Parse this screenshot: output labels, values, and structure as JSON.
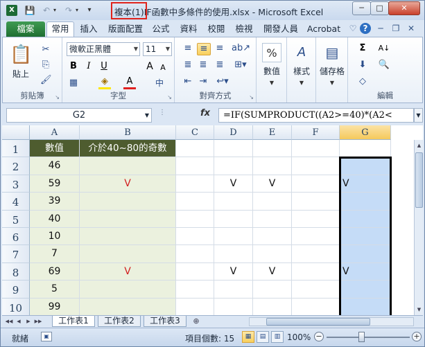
{
  "window": {
    "title": "複本(1)IF函數中多條件的使用.xlsx - Microsoft Excel",
    "minimize": "─",
    "maximize": "□",
    "close": "✕"
  },
  "quick_access": {
    "logo": "X",
    "save": "💾",
    "undo": "↶",
    "redo": "↷",
    "dropdown": "▾"
  },
  "tabs": {
    "file": "檔案",
    "items": [
      "常用",
      "插入",
      "版面配置",
      "公式",
      "資料",
      "校閱",
      "檢視",
      "開發人員",
      "Acrobat"
    ],
    "active": "常用",
    "icons": {
      "collapse": "♡",
      "help": "?",
      "min": "─",
      "restore": "❐",
      "close": "✕"
    }
  },
  "ribbon": {
    "clipboard": {
      "label": "剪貼簿",
      "paste": "貼上",
      "cut": "✂",
      "copy": "⎘",
      "format_painter": "🖌"
    },
    "font": {
      "label": "字型",
      "font_name": "微軟正黑體",
      "font_size": "11",
      "grow": "A",
      "shrink": "A",
      "bold": "B",
      "italic": "I",
      "underline": "U",
      "border": "▦",
      "fill": "◈",
      "color": "A",
      "phonetic": "中"
    },
    "alignment": {
      "label": "對齊方式"
    },
    "number": {
      "label": "數值",
      "icon": "%"
    },
    "styles": {
      "label": "樣式",
      "icon": "A"
    },
    "cells": {
      "label": "儲存格",
      "icon": "▤"
    },
    "editing": {
      "label": "編輯",
      "sum": "Σ",
      "sort": "A↓",
      "find": "🔍",
      "fill": "⬇",
      "clear": "◇"
    }
  },
  "formula_bar": {
    "name_box": "G2",
    "fx": "fx",
    "formula": "=IF(SUMPRODUCT((A2>=40)*(A2<"
  },
  "columns": [
    "A",
    "B",
    "C",
    "D",
    "E",
    "F",
    "G"
  ],
  "active_column": "G",
  "rows": [
    "1",
    "2",
    "3",
    "4",
    "5",
    "6",
    "7",
    "8",
    "9",
    "10"
  ],
  "cells": {
    "header_a": "數值",
    "header_b": "介於40~80的奇數",
    "a_values": [
      "46",
      "59",
      "39",
      "40",
      "10",
      "7",
      "69",
      "5",
      "99"
    ],
    "b_values": [
      "",
      "V",
      "",
      "",
      "",
      "",
      "V",
      "",
      ""
    ],
    "d_values": [
      "",
      "V",
      "",
      "",
      "",
      "",
      "V",
      "",
      ""
    ],
    "e_values": [
      "",
      "V",
      "",
      "",
      "",
      "",
      "V",
      "",
      ""
    ],
    "g_values": [
      "",
      "V",
      "",
      "",
      "",
      "",
      "V",
      "",
      ""
    ]
  },
  "sheets": {
    "tabs": [
      "工作表1",
      "工作表2",
      "工作表3"
    ],
    "active": "工作表1",
    "nav": [
      "◀◀",
      "◀",
      "▶",
      "▶▶"
    ]
  },
  "status": {
    "ready": "就緒",
    "count": "項目個數: 15",
    "zoom": "100%",
    "minus": "−",
    "plus": "+"
  }
}
